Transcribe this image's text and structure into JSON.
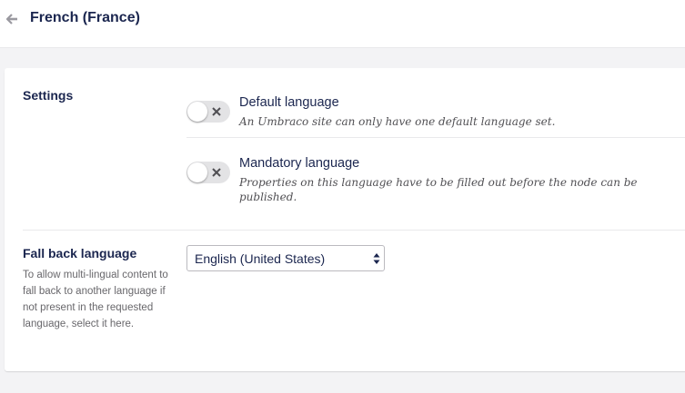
{
  "header": {
    "title": "French (France)",
    "back_icon": "arrow-left-icon"
  },
  "settings": {
    "label": "Settings",
    "options": [
      {
        "title": "Default language",
        "description": "An Umbraco site can only have one default language set.",
        "enabled": false
      },
      {
        "title": "Mandatory language",
        "description": "Properties on this language have to be filled out before the node can be published.",
        "enabled": false
      }
    ]
  },
  "fallback": {
    "label": "Fall back language",
    "description": "To allow multi-lingual content to fall back to another language if not present in the requested language, select it here.",
    "selected": "English (United States)"
  },
  "colors": {
    "title_text": "#1b264f",
    "toggle_off": "#e3e3e5",
    "page_bg": "#f3f3f5"
  }
}
